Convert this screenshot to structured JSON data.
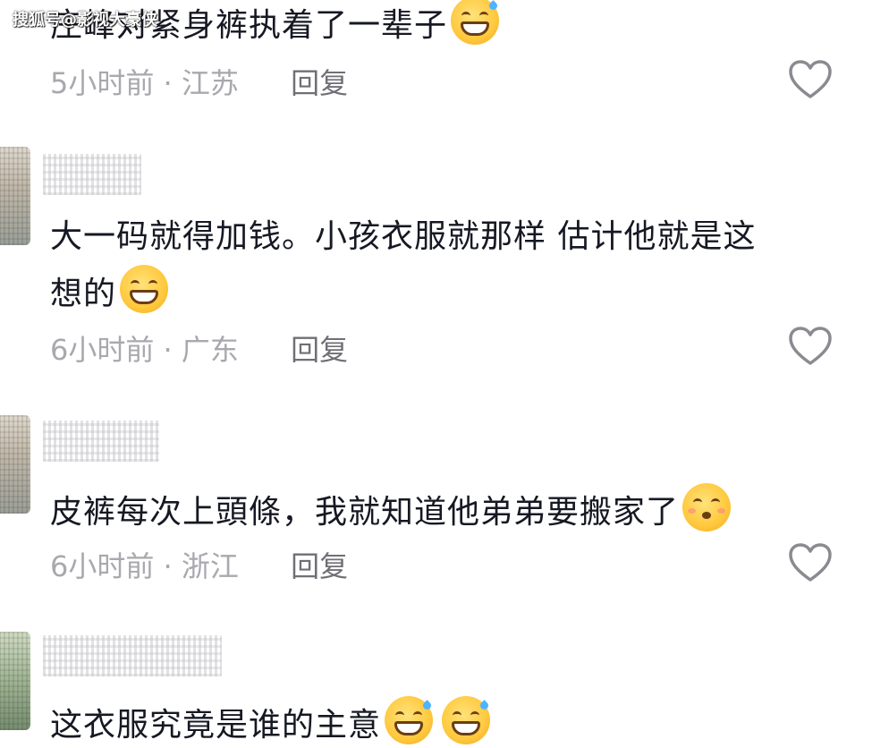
{
  "watermark": "搜狐号@影视大豪侠",
  "comments": [
    {
      "text": "庄峰对紧身裤执着了一辈子",
      "emoji": "rofl-emoji",
      "time": "5小时前",
      "location": "江苏",
      "reply_label": "回复"
    },
    {
      "text_line1": "大一码就得加钱。小孩衣服就那样 估计他就是这",
      "text_line2": "想的",
      "emoji": "grinning-emoji",
      "time": "6小时前",
      "location": "广东",
      "reply_label": "回复"
    },
    {
      "text": "皮裤每次上頭條，我就知道他弟弟要搬家了",
      "emoji": "kissing-emoji",
      "time": "6小时前",
      "location": "浙江",
      "reply_label": "回复"
    },
    {
      "text": "这衣服究竟是谁的主意",
      "emoji": "sweat-smile-emoji"
    }
  ],
  "separator": "·",
  "colors": {
    "text": "#161823",
    "meta": "#a8a8ae",
    "reply": "#6f6f76",
    "heart_outline": "#8a8a90"
  }
}
